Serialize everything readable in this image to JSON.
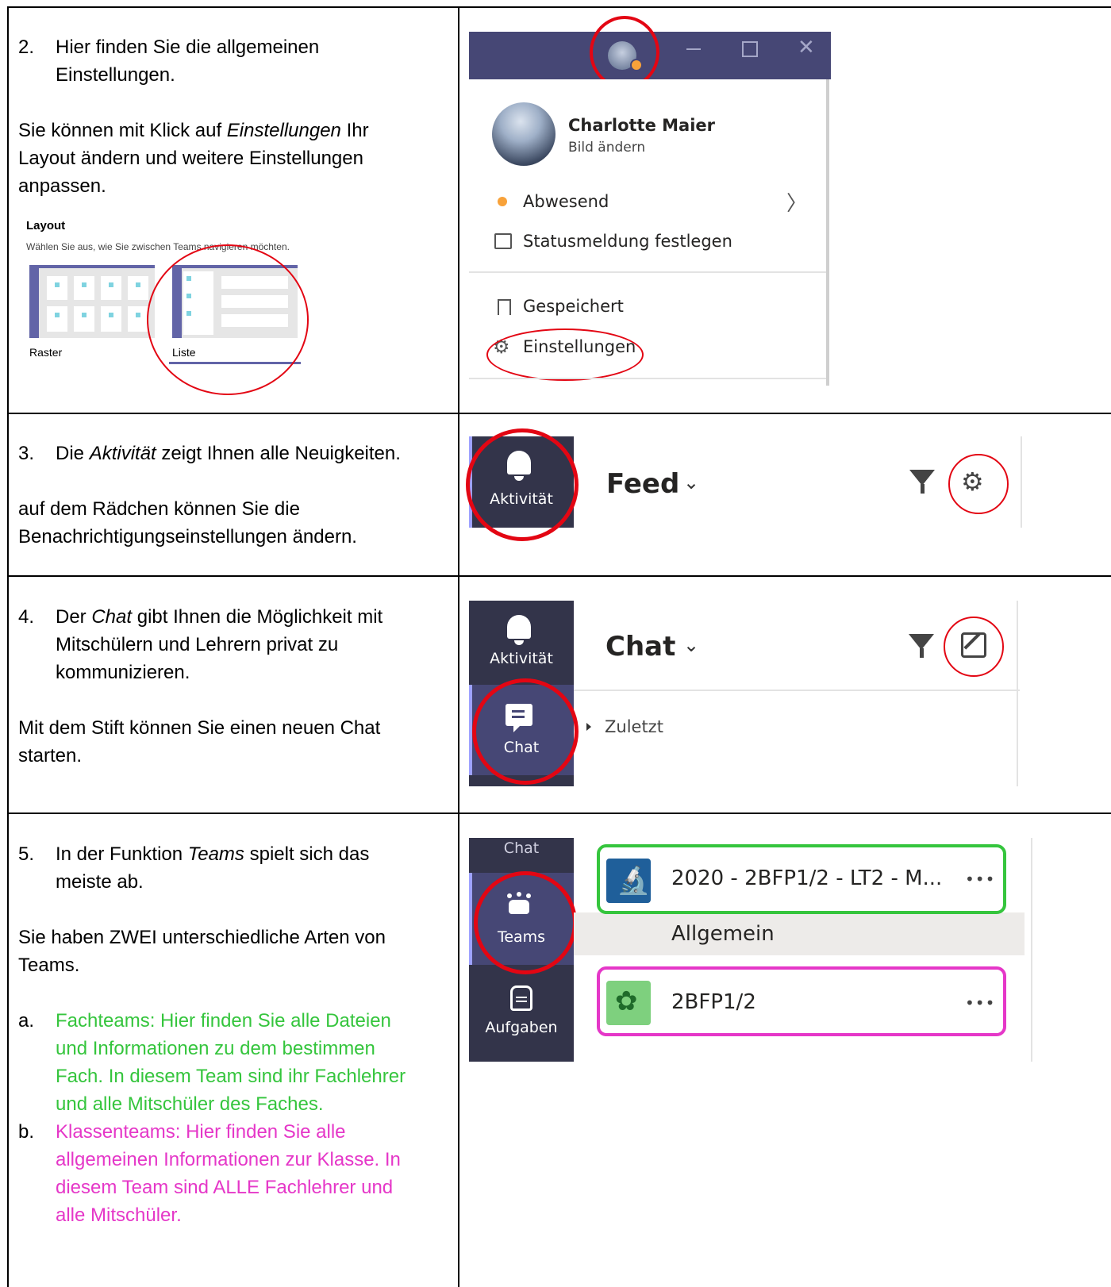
{
  "sections": [
    {
      "number": "2.",
      "line1": "Hier finden Sie die allgemeinen",
      "line2": "Einstellungen.",
      "p2_before": "Sie können mit Klick auf ",
      "p2_em": "Einstellungen",
      "p2_after": " Ihr",
      "p2_line2": "Layout ändern und weitere Einstellungen",
      "p2_line3": "anpassen.",
      "layout": {
        "title": "Layout",
        "subtitle": "Wählen Sie aus, wie Sie zwischen Teams navigieren möchten.",
        "option1": "Raster",
        "option2": "Liste"
      },
      "menu": {
        "name": "Charlotte Maier",
        "change_picture": "Bild ändern",
        "status": "Abwesend",
        "status_message": "Statusmeldung festlegen",
        "saved": "Gespeichert",
        "settings": "Einstellungen"
      }
    },
    {
      "number": "3.",
      "line1_before": "Die ",
      "line1_em": "Aktivität",
      "line1_after": " zeigt Ihnen alle Neuigkeiten.",
      "p2_line1": "auf dem Rädchen können Sie die",
      "p2_line2": "Benachrichtigungseinstellungen ändern.",
      "nav_label": "Aktivität",
      "header": "Feed"
    },
    {
      "number": "4.",
      "line1_before": "Der ",
      "line1_em": "Chat",
      "line1_after": " gibt Ihnen die Möglichkeit mit",
      "line2": "Mitschülern und Lehrern privat zu",
      "line3": "kommunizieren.",
      "p2_line1": "Mit dem Stift können Sie einen neuen Chat",
      "p2_line2": "starten.",
      "nav1": "Aktivität",
      "nav2": "Chat",
      "header": "Chat",
      "recent": "Zuletzt"
    },
    {
      "number": "5.",
      "line1_before": "In der Funktion ",
      "line1_em": "Teams",
      "line1_after": " spielt sich das",
      "line2": "meiste ab.",
      "p2_line1": "Sie haben ZWEI unterschiedliche Arten von",
      "p2_line2": "Teams.",
      "a_label": "a.",
      "a_lines": [
        "Fachteams: Hier finden Sie alle Dateien",
        "und Informationen zu dem bestimmen",
        "Fach. In diesem Team sind ihr Fachlehrer",
        "und alle Mitschüler des Faches."
      ],
      "b_label": "b.",
      "b_lines": [
        "Klassenteams: Hier finden Sie alle",
        "allgemeinen Informationen zur Klasse. In",
        "diesem Team sind ALLE Fachlehrer und",
        "alle Mitschüler."
      ],
      "nav_top": "Chat",
      "nav_teams": "Teams",
      "nav_tasks": "Aufgaben",
      "team1": "2020 - 2BFP1/2 - LT2 - M...",
      "channel": "Allgemein",
      "team2": "2BFP1/2",
      "more": "•••"
    }
  ],
  "colors": {
    "annotation_red": "#e30613",
    "green": "#35c53d",
    "pink": "#e537c8",
    "teams_sidebar": "#33344a",
    "teams_titlebar": "#464775"
  }
}
